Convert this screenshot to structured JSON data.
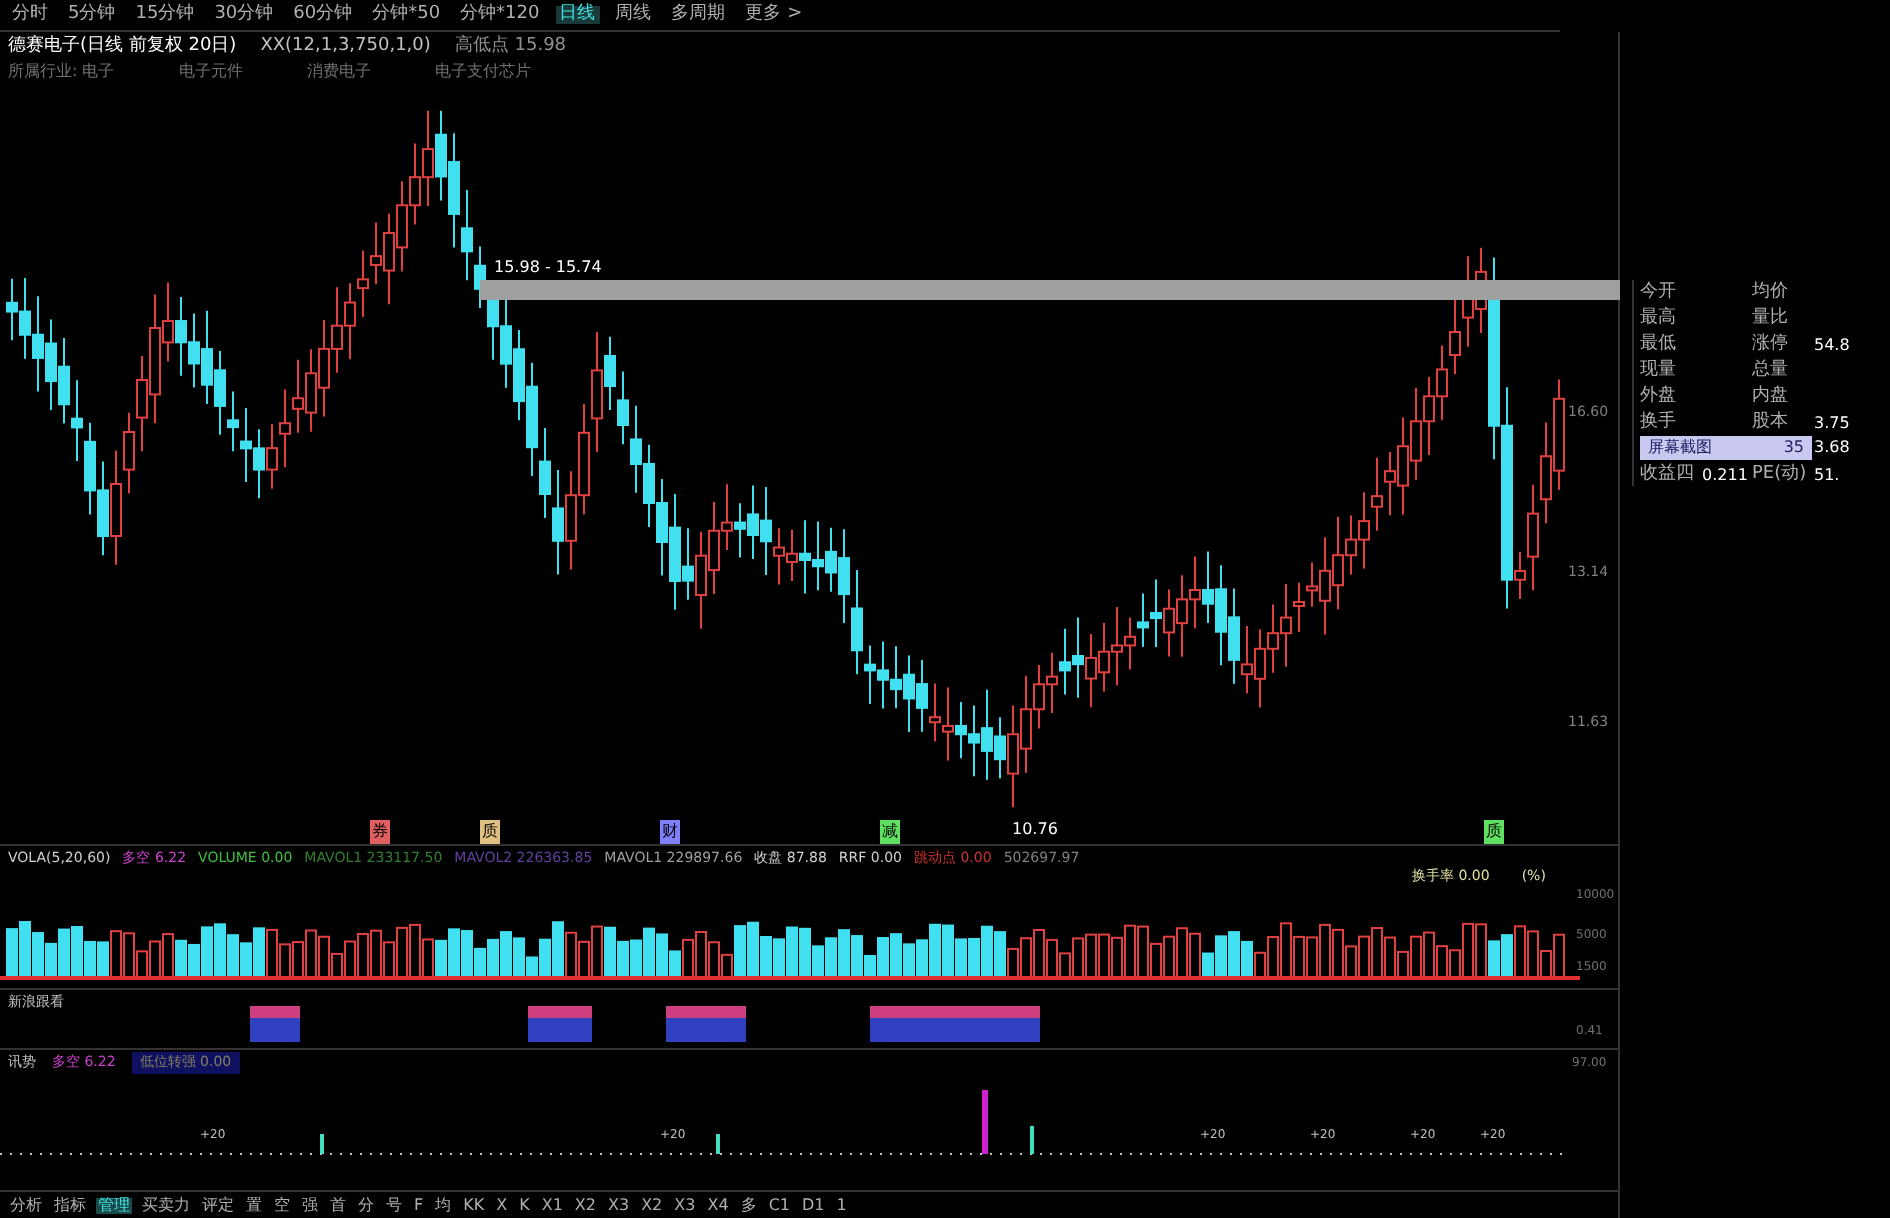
{
  "toolbar": [
    {
      "label": "分时",
      "selected": false
    },
    {
      "label": "5分钟",
      "selected": false
    },
    {
      "label": "15分钟",
      "selected": false
    },
    {
      "label": "30分钟",
      "selected": false
    },
    {
      "label": "60分钟",
      "selected": false
    },
    {
      "label": "分钟*50",
      "selected": false
    },
    {
      "label": "分钟*120",
      "selected": false
    },
    {
      "label": "日线",
      "selected": true
    },
    {
      "label": "周线",
      "selected": false
    },
    {
      "label": "多周期",
      "selected": false
    },
    {
      "label": "更多 >",
      "selected": false
    }
  ],
  "chart_header": {
    "title": "德赛电子(日线 前复权 20日)",
    "indicator": "XX(12,1,3,750,1,0)",
    "extra": "高低点 15.98",
    "info": [
      "所属行业: 电子",
      "电子元件",
      "消费电子",
      "电子支付芯片"
    ]
  },
  "price_annotations": {
    "high": "15.98 - 15.74",
    "low": "10.76"
  },
  "price_axis": [
    "16.60",
    "13.14",
    "11.63"
  ],
  "event_marks": [
    {
      "text": "券",
      "color": "#e06060"
    },
    {
      "text": "质",
      "color": "#e0c080"
    },
    {
      "text": "财",
      "color": "#8080ff"
    },
    {
      "text": "减",
      "color": "#60e060"
    },
    {
      "text": "质",
      "color": "#60e060"
    }
  ],
  "quote_panel": {
    "rows": [
      {
        "label_1": "今开",
        "label_2": "均价",
        "value_2": ""
      },
      {
        "label_1": "最高",
        "label_2": "量比",
        "value_2": ""
      },
      {
        "label_1": "最低",
        "label_2": "涨停",
        "value_2": "54.8"
      },
      {
        "label_1": "现量",
        "label_2": "总量",
        "value_2": ""
      },
      {
        "label_1": "外盘",
        "label_2": "内盘",
        "value_2": ""
      },
      {
        "label_1": "换手",
        "label_2": "股本",
        "value_2": "3.75"
      },
      {
        "label_1": "",
        "label_2": "",
        "value_2": "3.68"
      },
      {
        "label_1": "收益四",
        "value_1": "0.211",
        "label_2": "PE(动)",
        "value_2": "51."
      }
    ],
    "popup": {
      "label": "屏幕截图",
      "value": "35"
    }
  },
  "volume_panel": {
    "legend": [
      {
        "text": "VOLA(5,20,60)",
        "color": "#d0d0d0"
      },
      {
        "text": "多空 6.22",
        "color": "#d040d0"
      },
      {
        "text": "VOLUME 0.00",
        "color": "#40c040"
      },
      {
        "text": "MAVOL1 233117.50",
        "color": "#308030"
      },
      {
        "text": "MAVOL2 226363.85",
        "color": "#6040a0"
      },
      {
        "text": "MAVOL1 229897.66",
        "color": "#a0a0a0"
      },
      {
        "text": "收盘 87.88",
        "color": "#d0d0d0"
      },
      {
        "text": "RRF 0.00",
        "color": "#d0d0d0"
      },
      {
        "text": "跳动点 0.00",
        "color": "#d03030"
      },
      {
        "text": "502697.97",
        "color": "#808080"
      }
    ],
    "turnover": "换手率 0.00",
    "unit": "(%)",
    "axis": [
      "10000",
      "5000",
      "1500"
    ]
  },
  "signal_panel": {
    "title": "新浪跟看",
    "axis": "0.41"
  },
  "trend_panel": {
    "title": "讯势",
    "value": "多空 6.22",
    "sub": "低位转强 0.00",
    "axis": "97.00",
    "marks": [
      "+20",
      "+20",
      "+20",
      "+20",
      "+20",
      "+20"
    ]
  },
  "bottom_tabs": [
    {
      "label": "分析",
      "selected": false
    },
    {
      "label": "指标",
      "selected": false
    },
    {
      "label": "管理",
      "selected": true
    },
    {
      "label": "买卖力",
      "selected": false
    },
    {
      "label": "评定",
      "selected": false
    },
    {
      "label": "置",
      "selected": false
    },
    {
      "label": "空",
      "selected": false
    },
    {
      "label": "强",
      "selected": false
    },
    {
      "label": "首",
      "selected": false
    },
    {
      "label": "分",
      "selected": false
    },
    {
      "label": "号",
      "selected": false
    },
    {
      "label": "F",
      "selected": false
    },
    {
      "label": "均",
      "selected": false
    },
    {
      "label": "KK",
      "selected": false
    },
    {
      "label": "X",
      "selected": false
    },
    {
      "label": "K",
      "selected": false
    },
    {
      "label": "X1",
      "selected": false
    },
    {
      "label": "X2",
      "selected": false
    },
    {
      "label": "X3",
      "selected": false
    },
    {
      "label": "X2",
      "selected": false
    },
    {
      "label": "X3",
      "selected": false
    },
    {
      "label": "X4",
      "selected": false
    },
    {
      "label": "多",
      "selected": false
    },
    {
      "label": "C1",
      "selected": false
    },
    {
      "label": "D1",
      "selected": false
    },
    {
      "label": "1",
      "selected": false
    }
  ]
}
